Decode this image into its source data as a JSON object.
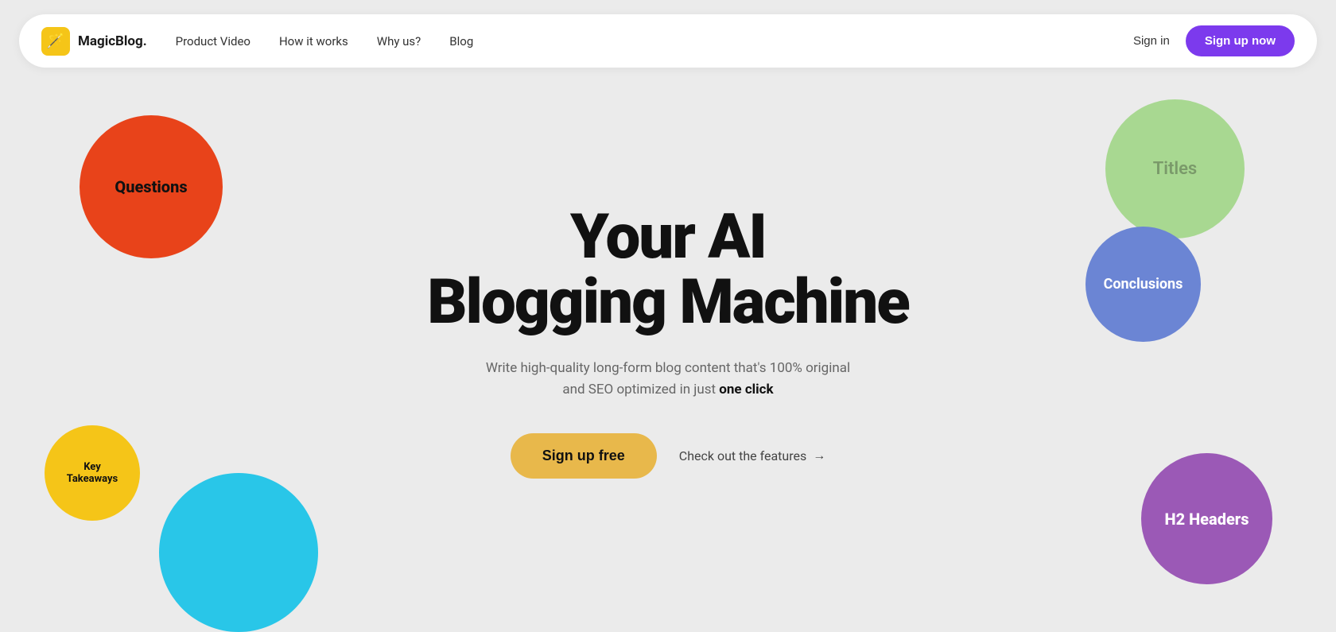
{
  "navbar": {
    "logo_icon": "🪄",
    "logo_text": "MagicBlog.",
    "nav_links": [
      {
        "label": "Product Video",
        "href": "#"
      },
      {
        "label": "How it works",
        "href": "#"
      },
      {
        "label": "Why us?",
        "href": "#"
      },
      {
        "label": "Blog",
        "href": "#"
      }
    ],
    "sign_in_label": "Sign in",
    "sign_up_label": "Sign up now"
  },
  "hero": {
    "title_line1": "Your AI",
    "title_line2": "Blogging Machine",
    "subtitle_plain": "Write high-quality long-form blog content that's 100% original",
    "subtitle_line2_plain": "and SEO optimized in just ",
    "subtitle_bold": "one click",
    "cta_signup": "Sign up free",
    "cta_features": "Check out the features"
  },
  "circles": {
    "questions": "Questions",
    "key_takeaways_line1": "Key",
    "key_takeaways_line2": "Takeaways",
    "titles": "Titles",
    "conclusions": "Conclusions",
    "h2_headers": "H2 Headers"
  },
  "colors": {
    "questions_bg": "#e8431a",
    "key_takeaways_bg": "#f5c518",
    "blue_partial_bg": "#29c6e8",
    "titles_bg": "#a8d891",
    "conclusions_bg": "#6b85d4",
    "h2headers_bg": "#9b59b6",
    "cta_purple": "#7c3aed",
    "cta_yellow": "#e8b84b"
  }
}
